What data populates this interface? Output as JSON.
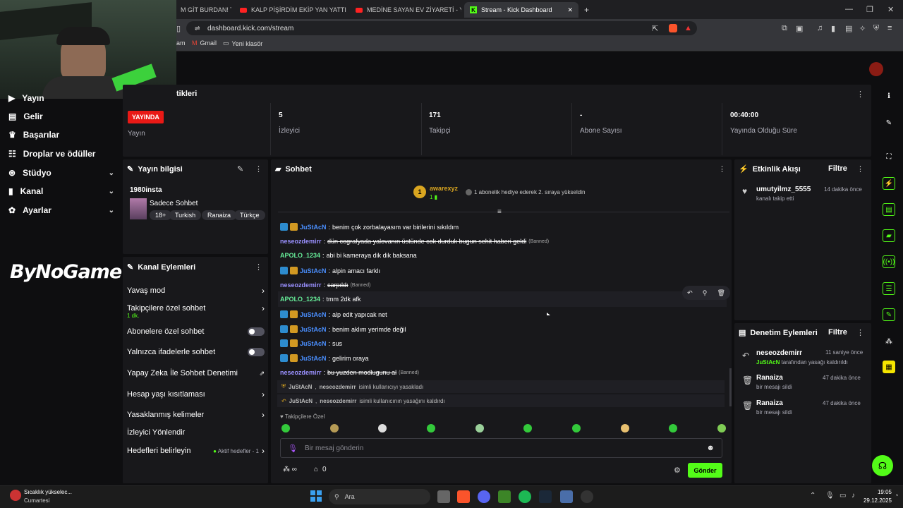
{
  "browser": {
    "tabs": [
      {
        "label": "M GİT BURDAN! Türi"
      },
      {
        "label": "KALP PİŞİRDİM EKİP YAN YATTI - Me"
      },
      {
        "label": "MEDİNE SAYAN EV ZİYARETİ - YouTu"
      },
      {
        "label": "Stream - Kick Dashboard"
      }
    ],
    "url": "dashboard.kick.com/stream",
    "bookmarks": [
      "am",
      "Gmail",
      "Yeni klasör"
    ]
  },
  "sidebar": {
    "items": [
      {
        "label": "Yayın"
      },
      {
        "label": "Gelir"
      },
      {
        "label": "Başarılar"
      },
      {
        "label": "Droplar ve ödüller"
      },
      {
        "label": "Stüdyo"
      },
      {
        "label": "Kanal"
      },
      {
        "label": "Ayarlar"
      }
    ],
    "logo": "ByNoGame"
  },
  "stats": {
    "title": "tikleri",
    "live_badge": "YAYINDA",
    "live_label": "Yayın",
    "viewers_value": "5",
    "viewers_label": "İzleyici",
    "followers_value": "171",
    "followers_label": "Takipçi",
    "subs_value": "-",
    "subs_label": "Abone Sayısı",
    "duration_value": "00:40:00",
    "duration_label": "Yayında Olduğu Süre"
  },
  "stream_info": {
    "title": "Yayın bilgisi",
    "channel": "1980insta",
    "stream_title": "Sadece Sohbet",
    "tags": [
      "18+",
      "Turkish",
      "Ranaiza",
      "Türkçe"
    ]
  },
  "channel_actions": {
    "title": "Kanal Eylemleri",
    "slow_mode": "Yavaş mod",
    "followers_only": "Takipçilere özel sohbet",
    "followers_only_sub": "1 dk.",
    "subs_only": "Abonelere özel sohbet",
    "emotes_only": "Yalnızca ifadelerle sohbet",
    "ai_moderation": "Yapay Zeka İle Sohbet Denetimi",
    "account_age": "Hesap yaşı kısıtlaması",
    "banned_words": "Yasaklanmış kelimeler",
    "viewer_redirect": "İzleyici Yönlendir",
    "goals": "Hedefleri belirleyin",
    "goals_status": "Aktif hedefler - 1"
  },
  "chat": {
    "title": "Sohbet",
    "pinned_user": "awarexyz",
    "pinned_rank": "1",
    "pinned_count": "1",
    "pinned_text": "1 abonelik hediye ederek 2. sıraya yükseldin",
    "messages": [
      {
        "user": "JuStAcN",
        "text": "benim çok zorbalayasım var birilerini sıkıldım"
      },
      {
        "user": "neseozdemirr",
        "text": "dün cografyada yalovanın üstünde cok durduk bugun sehit haberi geldi",
        "tag": "(Banned)"
      },
      {
        "user": "APOLO_1234",
        "text": "abi bi kameraya dik dik baksana"
      },
      {
        "user": "JuStAcN",
        "text": "alpin amacı farklı"
      },
      {
        "user": "neseozdemirr",
        "text": "carpıldı",
        "tag": "(Banned)"
      },
      {
        "user": "APOLO_1234",
        "text": "tmm 2dk afk"
      },
      {
        "user": "JuStAcN",
        "text": "alp edit yapıcak net"
      },
      {
        "user": "JuStAcN",
        "text": "benim aklım yerimde değil"
      },
      {
        "user": "JuStAcN",
        "text": "sus"
      },
      {
        "user": "JuStAcN",
        "text": "gelirim oraya"
      },
      {
        "user": "neseozdemirr",
        "text": "bu yuzden modlugunu al",
        "tag": "(Banned)"
      }
    ],
    "sys1": {
      "actor": "JuStAcN",
      "target": "neseozdemirr",
      "text": "isimli kullanıcıyı yasakladı"
    },
    "sys2": {
      "actor": "JuStAcN",
      "target": "neseozdemirr",
      "text": "isimli kullanıcının yasağını kaldırdı"
    },
    "followers_only_label": "Takipçilere Özel",
    "input_placeholder": "Bir mesaj gönderin",
    "points": "0",
    "send_label": "Gönder"
  },
  "activity": {
    "title": "Etkinlik Akışı",
    "filter": "Filtre",
    "user": "umutyilmz_5555",
    "text": "kanalı takip etti",
    "time": "14 dakika önce"
  },
  "moderation": {
    "title": "Denetim Eylemleri",
    "filter": "Filtre",
    "items": [
      {
        "user": "neseozdemirr",
        "actor": "JuStAcN",
        "text": "tarafından yasağı kaldırıldı",
        "time": "11 saniye önce"
      },
      {
        "user": "Ranaiza",
        "text": "bir mesajı sildi",
        "time": "47 dakika önce"
      },
      {
        "user": "Ranaiza",
        "text": "bir mesajı sildi",
        "time": "47 dakika önce"
      }
    ]
  },
  "taskbar": {
    "weather_title": "Sıcaklık yükselec...",
    "weather_sub": "Cumartesi",
    "search": "Ara",
    "time": "19:05",
    "date": "29.12.2025"
  },
  "colors": {
    "accent": "#53fc18",
    "live": "#e91916",
    "panel": "#18181b"
  }
}
